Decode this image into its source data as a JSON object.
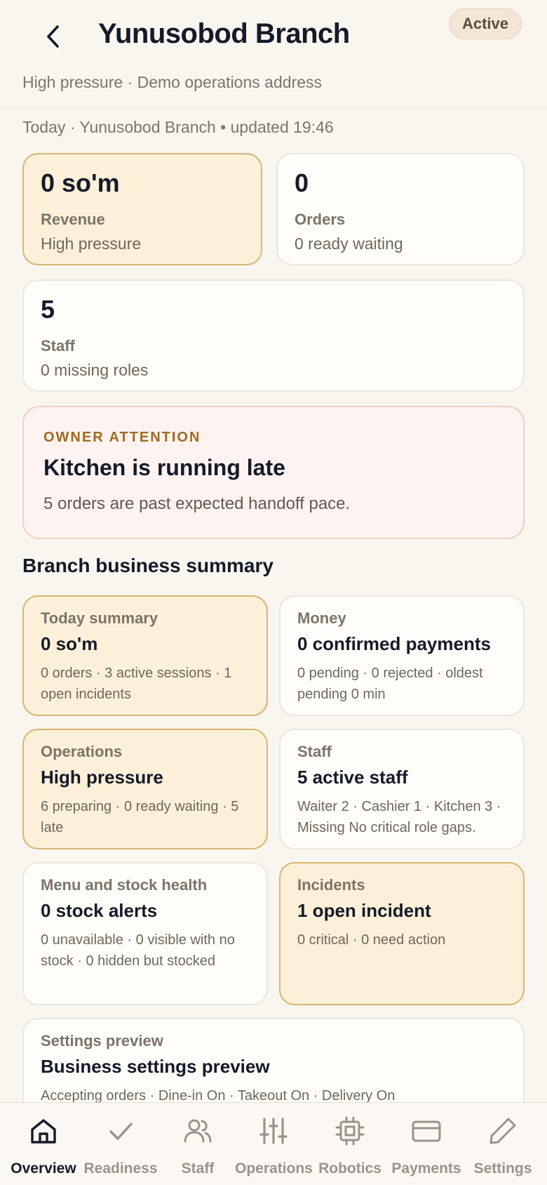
{
  "header": {
    "title": "Yunusobod Branch",
    "status": "Active",
    "subtitle": "High pressure · Demo operations address"
  },
  "updated_line": "Today · Yunusobod Branch • updated 19:46",
  "stats": {
    "revenue": {
      "value": "0 so'm",
      "label": "Revenue",
      "sub": "High pressure"
    },
    "orders": {
      "value": "0",
      "label": "Orders",
      "sub": "0 ready waiting"
    },
    "staff": {
      "value": "5",
      "label": "Staff",
      "sub": "0 missing roles"
    }
  },
  "attention": {
    "kicker": "OWNER ATTENTION",
    "title": "Kitchen is running late",
    "body": "5 orders are past expected handoff pace."
  },
  "summary": {
    "title": "Branch business summary",
    "cards": [
      {
        "label": "Today summary",
        "value": "0 so'm",
        "desc": "0 orders · 3 active sessions · 1 open incidents"
      },
      {
        "label": "Money",
        "value": "0 confirmed payments",
        "desc": "0 pending · 0 rejected · oldest pending 0 min"
      },
      {
        "label": "Operations",
        "value": "High pressure",
        "desc": "6 preparing · 0 ready waiting · 5 late"
      },
      {
        "label": "Staff",
        "value": "5 active staff",
        "desc": "Waiter 2 · Cashier 1 · Kitchen 3 · Missing No critical role gaps."
      },
      {
        "label": "Menu and stock health",
        "value": "0 stock alerts",
        "desc": "0 unavailable · 0 visible with no stock · 0 hidden but stocked"
      },
      {
        "label": "Incidents",
        "value": "1 open incident",
        "desc": "0 critical · 0 need action"
      },
      {
        "label": "Settings preview",
        "value": "Business settings preview",
        "desc": "Accepting orders · Dine-in On · Takeout On · Delivery On"
      }
    ]
  },
  "nav": [
    {
      "label": "Overview",
      "icon": "home-icon",
      "active": true
    },
    {
      "label": "Readiness",
      "icon": "check-icon",
      "active": false
    },
    {
      "label": "Staff",
      "icon": "users-icon",
      "active": false
    },
    {
      "label": "Operations",
      "icon": "sliders-icon",
      "active": false
    },
    {
      "label": "Robotics",
      "icon": "chip-icon",
      "active": false
    },
    {
      "label": "Payments",
      "icon": "card-icon",
      "active": false
    },
    {
      "label": "Settings",
      "icon": "pencil-icon",
      "active": false
    }
  ],
  "colors": {
    "accent_warm_bg": "#fdf0d9",
    "accent_warm_border": "#d7b673",
    "attention_bg": "#fff3f1",
    "kicker": "#a06a1f",
    "text_primary": "#141a28",
    "text_muted": "#7b7468"
  }
}
